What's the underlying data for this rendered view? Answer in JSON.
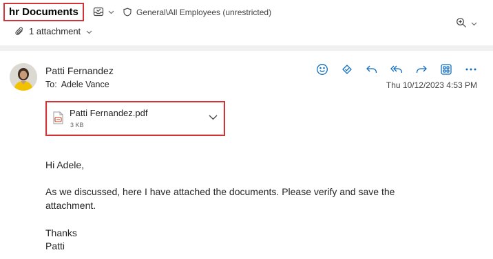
{
  "header": {
    "subject": "hr Documents",
    "sensitivity_label": "General\\All Employees (unrestricted)",
    "attachment_summary": "1 attachment",
    "icons": [
      "mail-status-icon",
      "chevron-down-icon",
      "shield-icon",
      "zoom-in-icon",
      "paperclip-icon"
    ]
  },
  "message": {
    "sender": "Patti Fernandez",
    "to_label": "To:",
    "to_name": "Adele Vance",
    "timestamp": "Thu 10/12/2023 4:53 PM",
    "actions": [
      "emoji-icon",
      "sticker-icon",
      "reply-icon",
      "reply-all-icon",
      "forward-icon",
      "apps-icon",
      "more-icon"
    ]
  },
  "attachment": {
    "file_name": "Patti Fernandez.pdf",
    "file_size": "3 KB"
  },
  "body": {
    "greeting": "Hi Adele,",
    "line1": "As we discussed, here I have attached the documents. Please verify and save the",
    "line2": "attachment.",
    "closing": "Thanks",
    "signature": "Patti"
  },
  "colors": {
    "accent": "#0f6cbd",
    "highlight_border": "#d13438",
    "pdf_red": "#c43e1c"
  }
}
